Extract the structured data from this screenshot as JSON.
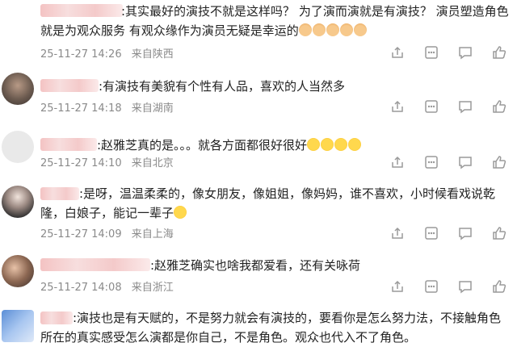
{
  "comments": [
    {
      "text": ":其实最好的演技不就是这样吗？  为了演而演就是有演技？   演员塑造角色就是为观众服务      有观众缘作为演员无疑是幸运的",
      "date": "25-11-27 14:26",
      "location": "来自陕西",
      "emoji": "cat-emoji"
    },
    {
      "text": ":有演技有美貌有个性有人品，喜欢的人当然多",
      "date": "25-11-27 14:18",
      "location": "来自湖南"
    },
    {
      "text": ":赵雅芝真的是。。。就各方面都很好很好",
      "date": "25-11-27 14:10",
      "location": "来自北京",
      "emoji": "laugh-emoji"
    },
    {
      "text": ":是呀，温温柔柔的，像女朋友，像姐姐，像妈妈，谁不喜欢，小时候看戏说乾隆，白娘子，能记一辈子",
      "date": "25-11-27 14:09",
      "location": "来自上海",
      "emoji": "laugh-emoji"
    },
    {
      "text": ":赵雅芝确实也啥我都爱看，还有关咏荷",
      "date": "25-11-27 14:08",
      "location": "来自浙江"
    },
    {
      "text": ":演技也是有天赋的，不是努力就会有演技的，要看你是怎么努力法，不接触角色所在的真实感受怎么演都是你自己，不是角色。观众也代入不了角色。"
    }
  ],
  "colors": {
    "meta": "#8a8a8a",
    "text": "#222222",
    "icon": "#9a9a9a",
    "name_blur": "#f4c3c3"
  },
  "icons": [
    "share-icon",
    "more-icon",
    "comment-icon",
    "like-icon"
  ]
}
